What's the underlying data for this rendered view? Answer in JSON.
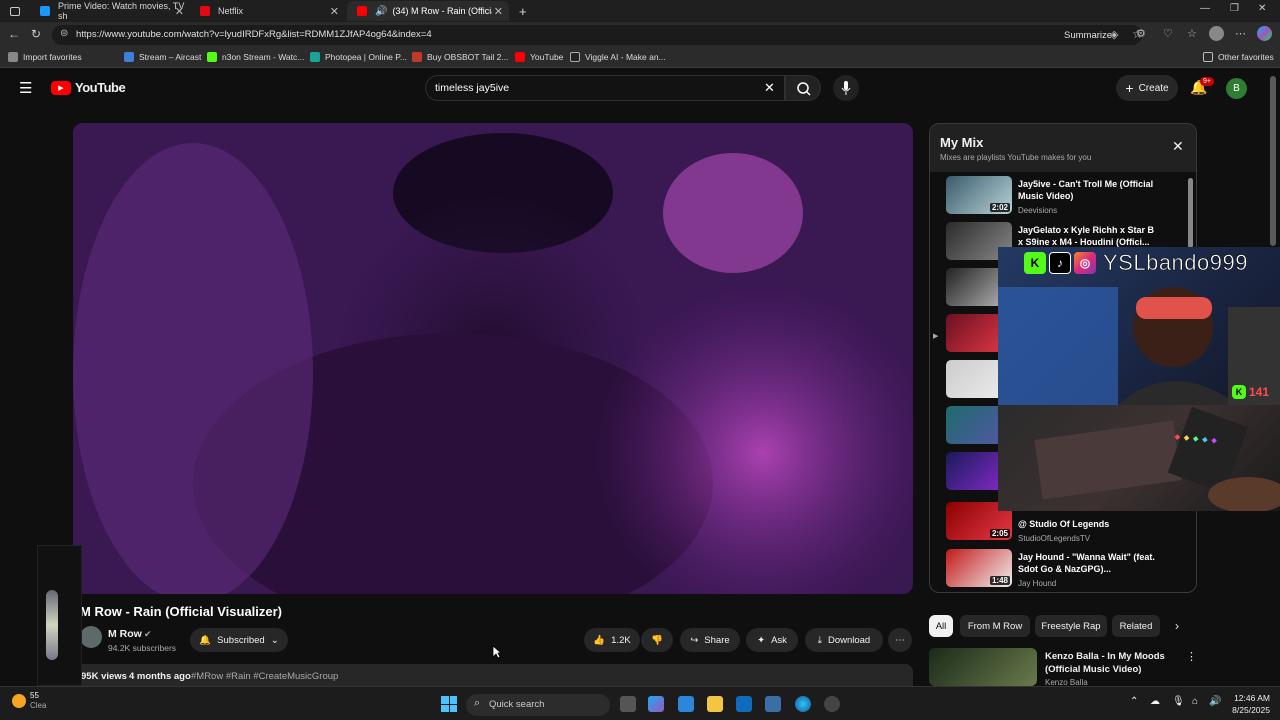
{
  "browser": {
    "tabs": [
      {
        "label": "Prime Video: Watch movies, TV sh",
        "color": "#1a98ff"
      },
      {
        "label": "Netflix",
        "color": "#e50914"
      },
      {
        "label": "(34) M Row - Rain (Official V",
        "color": "#ff0000"
      }
    ],
    "new_tab": "+",
    "url": "https://www.youtube.com/watch?v=lyudIRDFxRg&list=RDMM1ZJfAP4og64&index=4",
    "summarize": "Summarize",
    "bookmarks": [
      "Import favorites",
      "Stream – Aircast",
      "n3on Stream - Watc...",
      "Photopea | Online P...",
      "Buy OBSBOT Tail 2...",
      "YouTube",
      "Viggle AI - Make an..."
    ],
    "other_favorites": "Other favorites"
  },
  "youtube": {
    "logo": "YouTube",
    "search_value": "timeless jay5ive",
    "create": "Create",
    "notif_count": "9+",
    "avatar_letter": "B",
    "accent": "#ff0000"
  },
  "video": {
    "title": "M Row - Rain (Official Visualizer)",
    "channel": "M Row",
    "subscribers": "94.2K subscribers",
    "subscribed": "Subscribed",
    "likes": "1.2K",
    "share": "Share",
    "ask": "Ask",
    "download": "Download",
    "views": "95K views",
    "age": "4 months ago",
    "tags": "#MRow #Rain #CreateMusicGroup"
  },
  "mix": {
    "title": "My Mix",
    "subtitle": "Mixes are playlists YouTube makes for you",
    "items": [
      {
        "title": "Jay5ive - Can't Troll Me (Official Music Video)",
        "channel": "Deevisions",
        "duration": "2:02"
      },
      {
        "title": "JayGelato x Kyle Richh x Star B x S9ine x M4 - Houdini (Offici...",
        "channel": "",
        "duration": ""
      },
      {
        "title": "",
        "channel": "",
        "duration": ""
      },
      {
        "title": "",
        "channel": "",
        "duration": ""
      },
      {
        "title": "",
        "channel": "",
        "duration": ""
      },
      {
        "title": "",
        "channel": "",
        "duration": ""
      },
      {
        "title": "",
        "channel": "",
        "duration": ""
      },
      {
        "title": "@ Studio Of Legends",
        "channel": "StudioOfLegendsTV",
        "duration": "2:05"
      },
      {
        "title": "Jay Hound - \"Wanna Wait\" (feat. Sdot Go & NazGPG)...",
        "channel": "Jay Hound",
        "duration": "1:48"
      }
    ]
  },
  "overlay": {
    "handle": "YSLbando999",
    "kick_count": "141"
  },
  "chips": [
    "All",
    "From M Row",
    "Freestyle Rap",
    "Related"
  ],
  "related": {
    "title": "Kenzo Balla - In My Moods (Official Music Video)",
    "channel": "Kenzo Balla"
  },
  "taskbar": {
    "search": "Quick search",
    "time": "12:46 AM",
    "date": "8/25/2025",
    "weather": "55",
    "weather_sub": "Clea"
  }
}
